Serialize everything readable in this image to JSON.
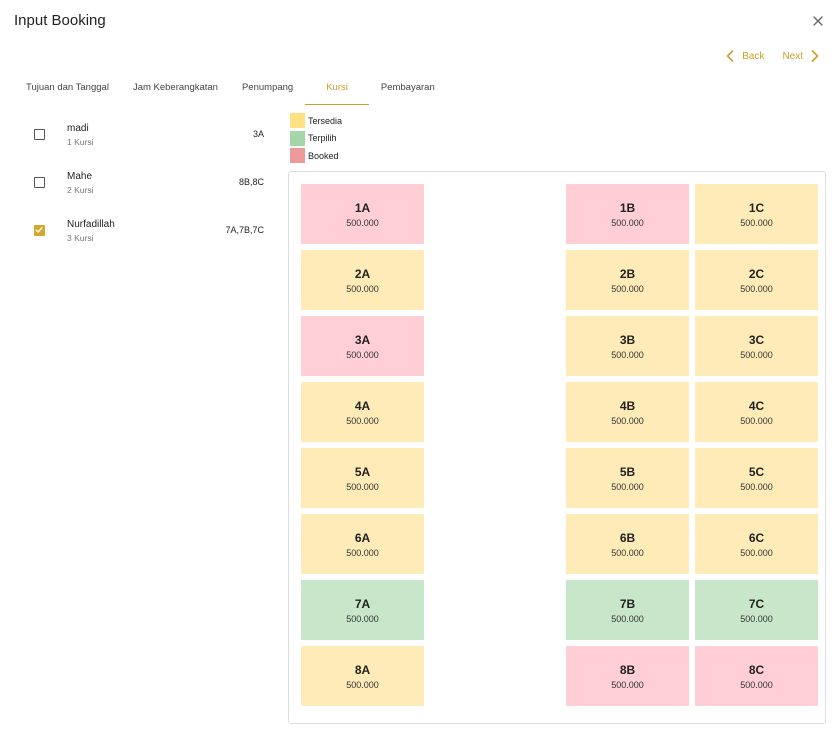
{
  "dialog": {
    "title": "Input Booking",
    "back_label": "Back",
    "next_label": "Next"
  },
  "tabs": [
    {
      "label": "Tujuan dan Tanggal",
      "active": false
    },
    {
      "label": "Jam Keberangkatan",
      "active": false
    },
    {
      "label": "Penumpang",
      "active": false
    },
    {
      "label": "Kursi",
      "active": true
    },
    {
      "label": "Pembayaran",
      "active": false
    }
  ],
  "passengers": [
    {
      "name": "madi",
      "count": "1 Kursi",
      "seats": "3A",
      "checked": false
    },
    {
      "name": "Mahe",
      "count": "2 Kursi",
      "seats": "8B,8C",
      "checked": false
    },
    {
      "name": "Nurfadillah",
      "count": "3 Kursi",
      "seats": "7A,7B,7C",
      "checked": true
    }
  ],
  "legend": [
    {
      "label": "Tersedia",
      "color": "#ffe082"
    },
    {
      "label": "Terpilih",
      "color": "#a5d6a7"
    },
    {
      "label": "Booked",
      "color": "#ef9a9a"
    }
  ],
  "colors": {
    "accent": "#c9a227",
    "available": "#feebb8",
    "selected": "#c8e6c9",
    "booked": "#ffcfd5"
  },
  "seats": [
    {
      "label": "1A",
      "price": "500.000",
      "status": "booked"
    },
    {
      "label": "1B",
      "price": "500.000",
      "status": "booked"
    },
    {
      "label": "1C",
      "price": "500.000",
      "status": "available"
    },
    {
      "label": "2A",
      "price": "500.000",
      "status": "available"
    },
    {
      "label": "2B",
      "price": "500.000",
      "status": "available"
    },
    {
      "label": "2C",
      "price": "500.000",
      "status": "available"
    },
    {
      "label": "3A",
      "price": "500.000",
      "status": "booked"
    },
    {
      "label": "3B",
      "price": "500.000",
      "status": "available"
    },
    {
      "label": "3C",
      "price": "500.000",
      "status": "available"
    },
    {
      "label": "4A",
      "price": "500.000",
      "status": "available"
    },
    {
      "label": "4B",
      "price": "500.000",
      "status": "available"
    },
    {
      "label": "4C",
      "price": "500.000",
      "status": "available"
    },
    {
      "label": "5A",
      "price": "500.000",
      "status": "available"
    },
    {
      "label": "5B",
      "price": "500.000",
      "status": "available"
    },
    {
      "label": "5C",
      "price": "500.000",
      "status": "available"
    },
    {
      "label": "6A",
      "price": "500.000",
      "status": "available"
    },
    {
      "label": "6B",
      "price": "500.000",
      "status": "available"
    },
    {
      "label": "6C",
      "price": "500.000",
      "status": "available"
    },
    {
      "label": "7A",
      "price": "500.000",
      "status": "selected"
    },
    {
      "label": "7B",
      "price": "500.000",
      "status": "selected"
    },
    {
      "label": "7C",
      "price": "500.000",
      "status": "selected"
    },
    {
      "label": "8A",
      "price": "500.000",
      "status": "available"
    },
    {
      "label": "8B",
      "price": "500.000",
      "status": "booked"
    },
    {
      "label": "8C",
      "price": "500.000",
      "status": "booked"
    }
  ]
}
